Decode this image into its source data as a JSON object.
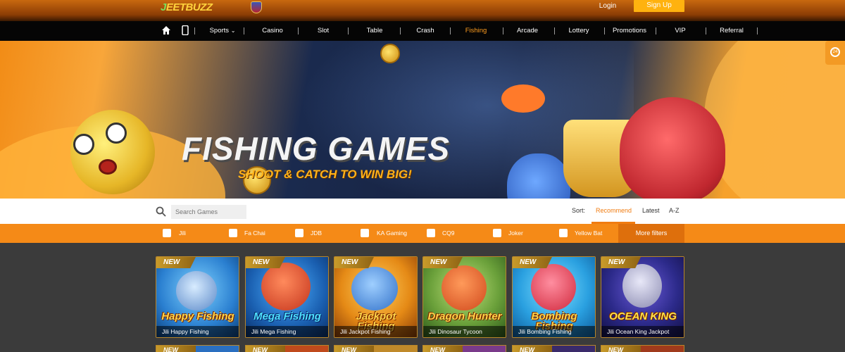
{
  "header": {
    "logo_text": "JeetBuzz",
    "login_label": "Login",
    "signup_label": "Sign Up"
  },
  "nav": {
    "items": [
      {
        "label": "Sports",
        "icon": "chevron-down-icon"
      },
      {
        "label": "Casino"
      },
      {
        "label": "Slot"
      },
      {
        "label": "Table"
      },
      {
        "label": "Crash"
      },
      {
        "label": "Fishing",
        "active": true
      },
      {
        "label": "Arcade"
      },
      {
        "label": "Lottery"
      },
      {
        "label": "Promotions"
      },
      {
        "label": "VIP"
      },
      {
        "label": "Referral"
      }
    ],
    "icons": [
      "home-icon",
      "mobile-icon"
    ]
  },
  "banner": {
    "title": "FISHING GAMES",
    "subtitle": "SHOOT & CATCH TO WIN BIG!"
  },
  "side_widget": {
    "text": "24"
  },
  "search": {
    "placeholder": "Search Games"
  },
  "sort": {
    "label": "Sort:",
    "options": [
      {
        "label": "Recommend",
        "active": true
      },
      {
        "label": "Latest"
      },
      {
        "label": "A-Z"
      }
    ]
  },
  "filters": {
    "providers": [
      "Jili",
      "Fa Chai",
      "JDB",
      "KA Gaming",
      "CQ9",
      "Joker",
      "Yellow Bat"
    ],
    "more_label": "More filters"
  },
  "games": [
    {
      "badge": "NEW",
      "logo": "Happy Fishing",
      "name": "Jili Happy Fishing"
    },
    {
      "badge": "NEW",
      "logo": "Mega Fishing",
      "name": "Jili Mega Fishing"
    },
    {
      "badge": "NEW",
      "logo": "Jackpot Fishing",
      "name": "Jili Jackpot Fishing"
    },
    {
      "badge": "NEW",
      "logo": "Dragon Hunter",
      "name": "Jili Dinosaur Tycoon"
    },
    {
      "badge": "NEW",
      "logo": "Bombing Fishing",
      "name": "Jili Bombing Fishing"
    },
    {
      "badge": "NEW",
      "logo": "OCEAN KING",
      "name": "Jili Ocean King Jackpot"
    }
  ],
  "games_row2": [
    "NEW",
    "NEW",
    "NEW",
    "NEW",
    "NEW",
    "NEW"
  ],
  "colors": {
    "accent": "#f58a17",
    "active_nav": "#ff9d1f",
    "signup": "#ffb20f",
    "page_bg": "#3b3b3b"
  }
}
